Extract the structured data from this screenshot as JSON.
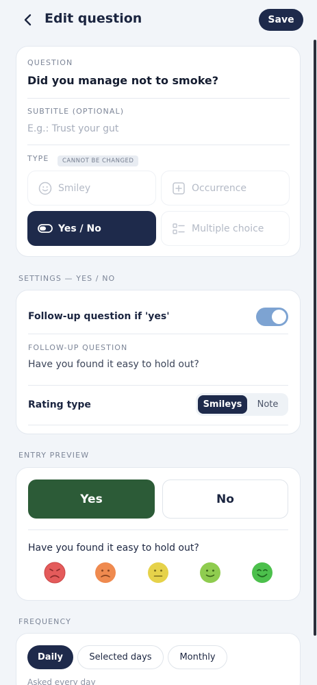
{
  "header": {
    "title": "Edit question",
    "save_label": "Save"
  },
  "question": {
    "label": "QUESTION",
    "value": "Did you manage not to smoke?",
    "subtitle_label": "SUBTITLE (OPTIONAL)",
    "subtitle_placeholder": "E.g.: Trust your gut",
    "type_label": "TYPE",
    "type_badge": "CANNOT BE CHANGED",
    "types": [
      {
        "label": "Smiley",
        "icon": "smiley-icon",
        "selected": false
      },
      {
        "label": "Occurrence",
        "icon": "plus-square-icon",
        "selected": false
      },
      {
        "label": "Yes / No",
        "icon": "toggle-icon",
        "selected": true
      },
      {
        "label": "Multiple choice",
        "icon": "list-icon",
        "selected": false
      }
    ]
  },
  "settings": {
    "section_label": "SETTINGS — YES / NO",
    "followup_toggle_label": "Follow-up question if 'yes'",
    "followup_enabled": true,
    "followup_question_label": "FOLLOW-UP QUESTION",
    "followup_question_value": "Have you found it easy to hold out?",
    "rating_type_label": "Rating type",
    "rating_options": [
      "Smileys",
      "Note"
    ],
    "rating_selected": "Smileys"
  },
  "preview": {
    "section_label": "ENTRY PREVIEW",
    "yes_label": "Yes",
    "no_label": "No",
    "followup_text": "Have you found it easy to hold out?",
    "faces": [
      {
        "name": "very-sad",
        "color": "#e45b5b"
      },
      {
        "name": "sad",
        "color": "#ef8a4f"
      },
      {
        "name": "neutral",
        "color": "#e6d24a"
      },
      {
        "name": "happy",
        "color": "#8fcc4f"
      },
      {
        "name": "very-happy",
        "color": "#4cc04c"
      }
    ]
  },
  "frequency": {
    "section_label": "FREQUENCY",
    "options": [
      "Daily",
      "Selected days",
      "Monthly"
    ],
    "selected": "Daily",
    "note": "Asked every day"
  },
  "colors": {
    "navy": "#1e2a4b",
    "green": "#2c5b37",
    "toggle": "#7da3d2",
    "background": "#f2f5f9"
  }
}
